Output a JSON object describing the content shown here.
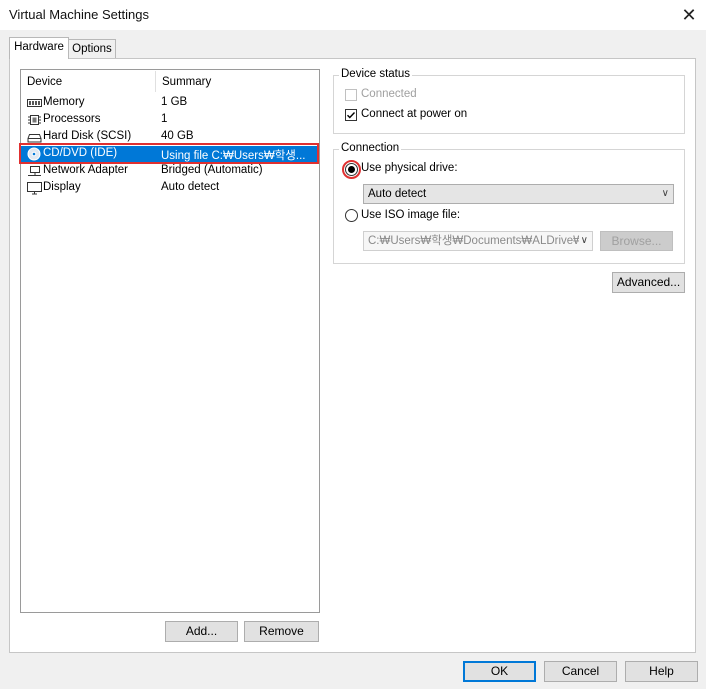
{
  "window": {
    "title": "Virtual Machine Settings",
    "close_glyph": "✕"
  },
  "tabs": [
    {
      "label": "Hardware",
      "active": true
    },
    {
      "label": "Options",
      "active": false
    }
  ],
  "device_list": {
    "headers": {
      "device": "Device",
      "summary": "Summary"
    },
    "rows": [
      {
        "name": "Memory",
        "summary": "1 GB",
        "icon": "memory-icon"
      },
      {
        "name": "Processors",
        "summary": "1",
        "icon": "processor-icon"
      },
      {
        "name": "Hard Disk (SCSI)",
        "summary": "40 GB",
        "icon": "hard-disk-icon"
      },
      {
        "name": "CD/DVD (IDE)",
        "summary": "Using file C:₩Users₩학생...",
        "icon": "cd-dvd-icon",
        "selected": true
      },
      {
        "name": "Network Adapter",
        "summary": "Bridged (Automatic)",
        "icon": "network-adapter-icon"
      },
      {
        "name": "Display",
        "summary": "Auto detect",
        "icon": "display-icon"
      }
    ],
    "add_label": "Add...",
    "remove_label": "Remove"
  },
  "device_status": {
    "title": "Device status",
    "connected_label": "Connected",
    "connected_checked": false,
    "connect_power_on_label": "Connect at power on",
    "connect_power_on_checked": true
  },
  "connection": {
    "title": "Connection",
    "physical_label": "Use physical drive:",
    "physical_selected": true,
    "physical_value": "Auto detect",
    "iso_label": "Use ISO image file:",
    "iso_selected": false,
    "iso_path": "C:₩Users₩학생₩Documents₩ALDrive₩",
    "browse_label": "Browse..."
  },
  "advanced_label": "Advanced...",
  "footer": {
    "ok_label": "OK",
    "cancel_label": "Cancel",
    "help_label": "Help"
  },
  "colors": {
    "selection": "#0078d7",
    "highlight": "#e03030"
  }
}
